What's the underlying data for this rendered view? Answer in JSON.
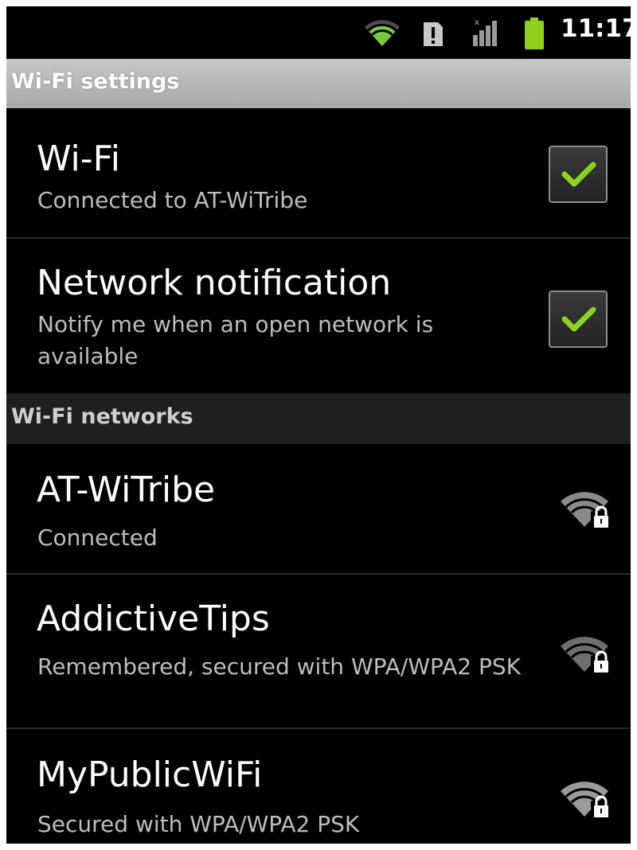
{
  "status_bar": {
    "time": "11:17",
    "icons": [
      "wifi-signal-icon",
      "sim-alert-icon",
      "cell-signal-icon",
      "battery-icon"
    ],
    "colors": {
      "wifi": "#7ac943",
      "battery": "#8ed21f"
    }
  },
  "title_bar": {
    "title": "Wi-Fi settings"
  },
  "settings": [
    {
      "title": "Wi-Fi",
      "summary": "Connected to AT-WiTribe",
      "checked": true
    },
    {
      "title": "Network notification",
      "summary": "Notify me when an open network is available",
      "checked": true
    }
  ],
  "networks_header": "Wi-Fi networks",
  "networks": [
    {
      "ssid": "AT-WiTribe",
      "status": "Connected",
      "icon": "wifi-lock-icon"
    },
    {
      "ssid": "AddictiveTips",
      "status": "Remembered, secured with WPA/WPA2 PSK",
      "icon": "wifi-lock-icon"
    },
    {
      "ssid": "MyPublicWiFi",
      "status": "Secured with WPA/WPA2 PSK",
      "icon": "wifi-lock-icon"
    }
  ],
  "colors": {
    "check": "#8ed21f",
    "background": "#000000"
  }
}
